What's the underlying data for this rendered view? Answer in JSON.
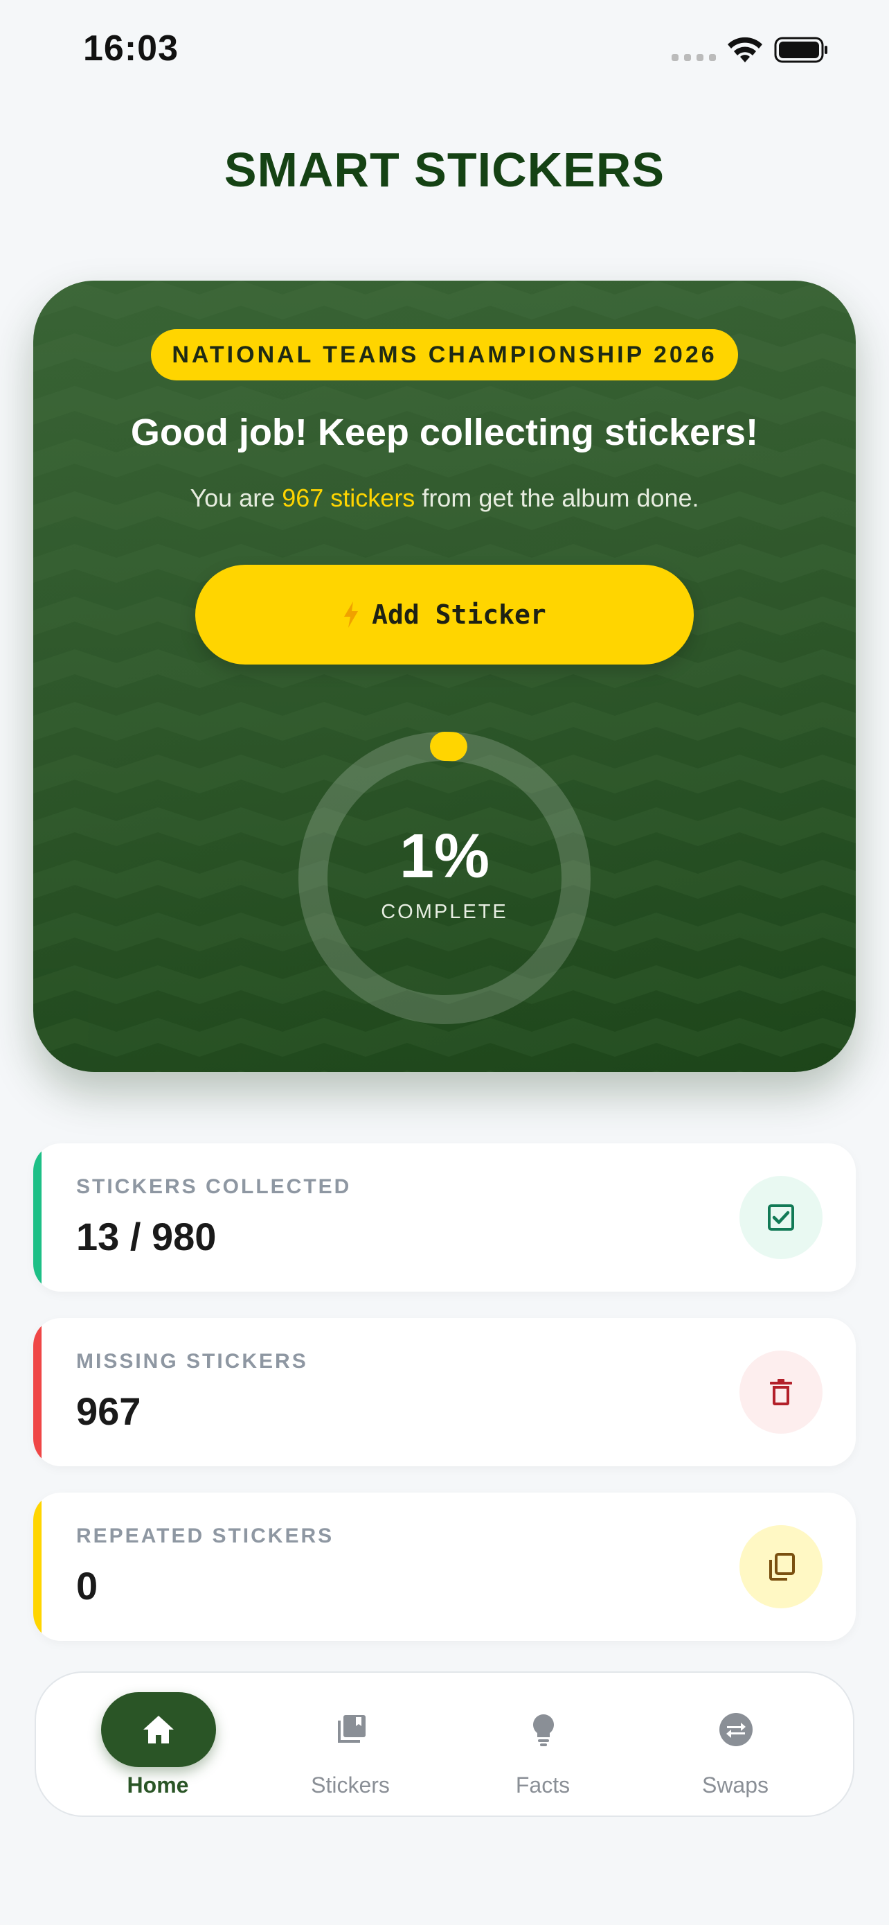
{
  "status_bar": {
    "time": "16:03"
  },
  "app": {
    "title": "SMART STICKERS"
  },
  "hero": {
    "badge": "NATIONAL TEAMS CHAMPIONSHIP 2026",
    "headline": "Good job! Keep collecting stickers!",
    "sub_prefix": "You are ",
    "sub_highlight": "967 stickers",
    "sub_suffix": " from get the album done.",
    "add_button_label": "Add Sticker",
    "progress_percent": 1,
    "progress_text": "1%",
    "progress_label": "COMPLETE"
  },
  "stats": [
    {
      "label": "STICKERS COLLECTED",
      "value": "13 / 980",
      "accent": "#1dbf86",
      "icon": "check-square-icon",
      "icon_bg": "#e9f9f2",
      "icon_color": "#127a56"
    },
    {
      "label": "MISSING STICKERS",
      "value": "967",
      "accent": "#ef4646",
      "icon": "trash-icon",
      "icon_bg": "#fdeeee",
      "icon_color": "#b3202a"
    },
    {
      "label": "REPEATED STICKERS",
      "value": "0",
      "accent": "#ffd500",
      "icon": "copy-icon",
      "icon_bg": "#fff8c4",
      "icon_color": "#7a5010"
    }
  ],
  "nav": [
    {
      "label": "Home",
      "icon": "home-icon",
      "active": true
    },
    {
      "label": "Stickers",
      "icon": "album-icon",
      "active": false
    },
    {
      "label": "Facts",
      "icon": "lightbulb-icon",
      "active": false
    },
    {
      "label": "Swaps",
      "icon": "swap-icon",
      "active": false
    }
  ],
  "colors": {
    "brand_green": "#2a5526",
    "title_green": "#154214",
    "accent_yellow": "#ffd500"
  }
}
